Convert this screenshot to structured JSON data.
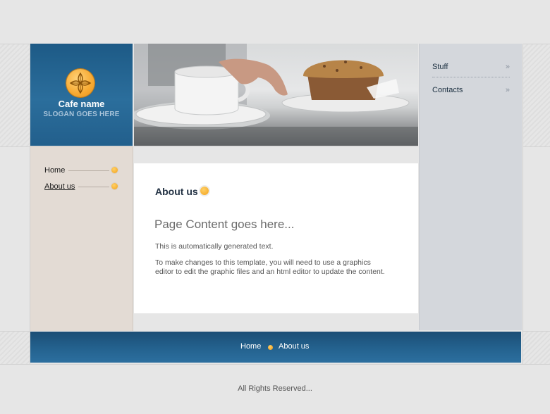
{
  "brand": {
    "name": "Cafe name",
    "slogan": "SLOGAN GOES HERE"
  },
  "left_nav": {
    "items": [
      {
        "label": "Home",
        "active": false
      },
      {
        "label": "About us",
        "active": true
      }
    ]
  },
  "right_nav": {
    "items": [
      {
        "label": "Stuff",
        "chevron": "»"
      },
      {
        "label": "Contacts",
        "chevron": "»"
      }
    ]
  },
  "main": {
    "heading": "About us",
    "title": "Page Content goes here...",
    "paragraphs": [
      "This is automatically generated text.",
      "To make changes to this template, you will need to use a graphics editor to edit the graphic files and an html editor to update the content."
    ]
  },
  "footer": {
    "links": [
      "Home",
      "About us"
    ],
    "copyright": "All Rights Reserved..."
  },
  "colors": {
    "accent": "#f2a21c",
    "brand_blue": "#235f8b",
    "left_sidebar": "#e3dbd4",
    "right_sidebar": "#d4d7dc"
  }
}
